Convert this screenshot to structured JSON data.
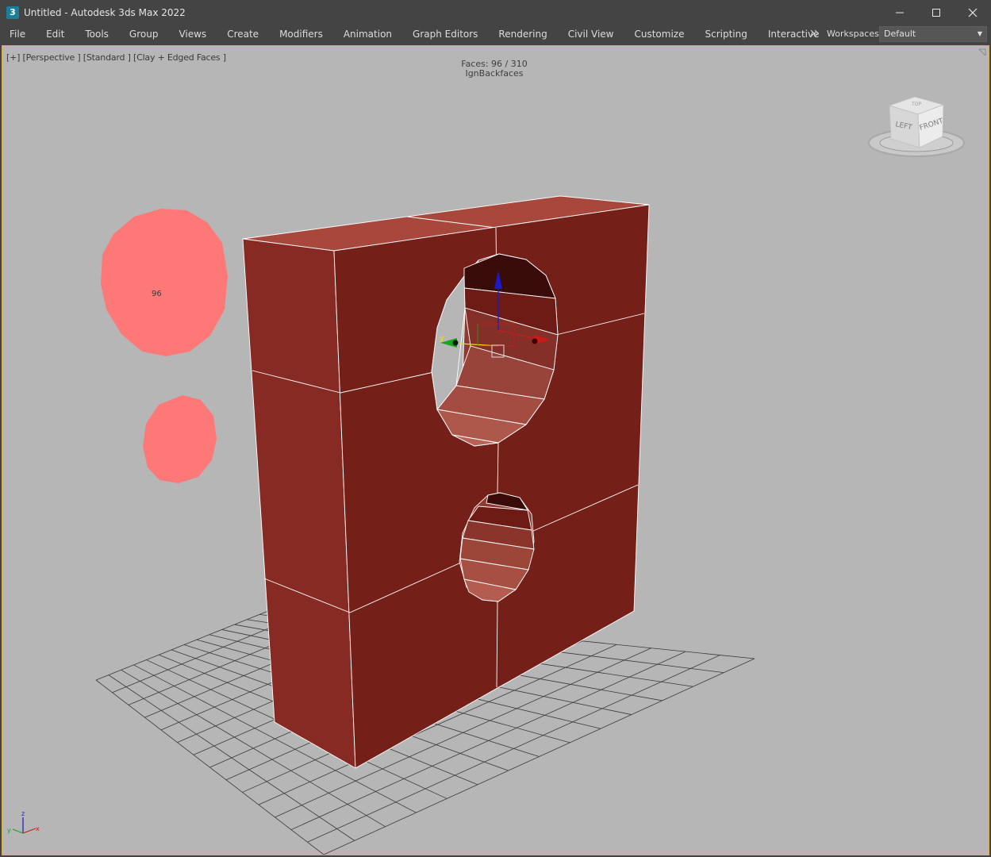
{
  "window": {
    "title": "Untitled - Autodesk 3ds Max 2022",
    "logo_text": "3"
  },
  "menu": {
    "items": [
      "File",
      "Edit",
      "Tools",
      "Group",
      "Views",
      "Create",
      "Modifiers",
      "Animation",
      "Graph Editors",
      "Rendering",
      "Civil View",
      "Customize",
      "Scripting",
      "Interactive"
    ]
  },
  "workspaces": {
    "label": "Workspaces:",
    "value": "Default"
  },
  "viewport": {
    "label": "[+] [Perspective ] [Standard ] [Clay + Edged Faces ]",
    "faces_stat": "Faces: 96 / 310",
    "option_stat": "IgnBackfaces",
    "selection_count": "96",
    "viewcube": {
      "left": "LEFT",
      "front": "FRONT",
      "top": "TOP"
    },
    "axis_tripod": {
      "x": "x",
      "y": "y",
      "z": "z"
    },
    "gizmo_y": "y",
    "colors": {
      "background": "#b6b6b6",
      "mesh_front": "#751f19",
      "mesh_side": "#872a24",
      "mesh_top": "#a8473b",
      "selection": "#ff7878",
      "grid": "#3a3a3a",
      "active_border": "#d6b14c"
    }
  }
}
